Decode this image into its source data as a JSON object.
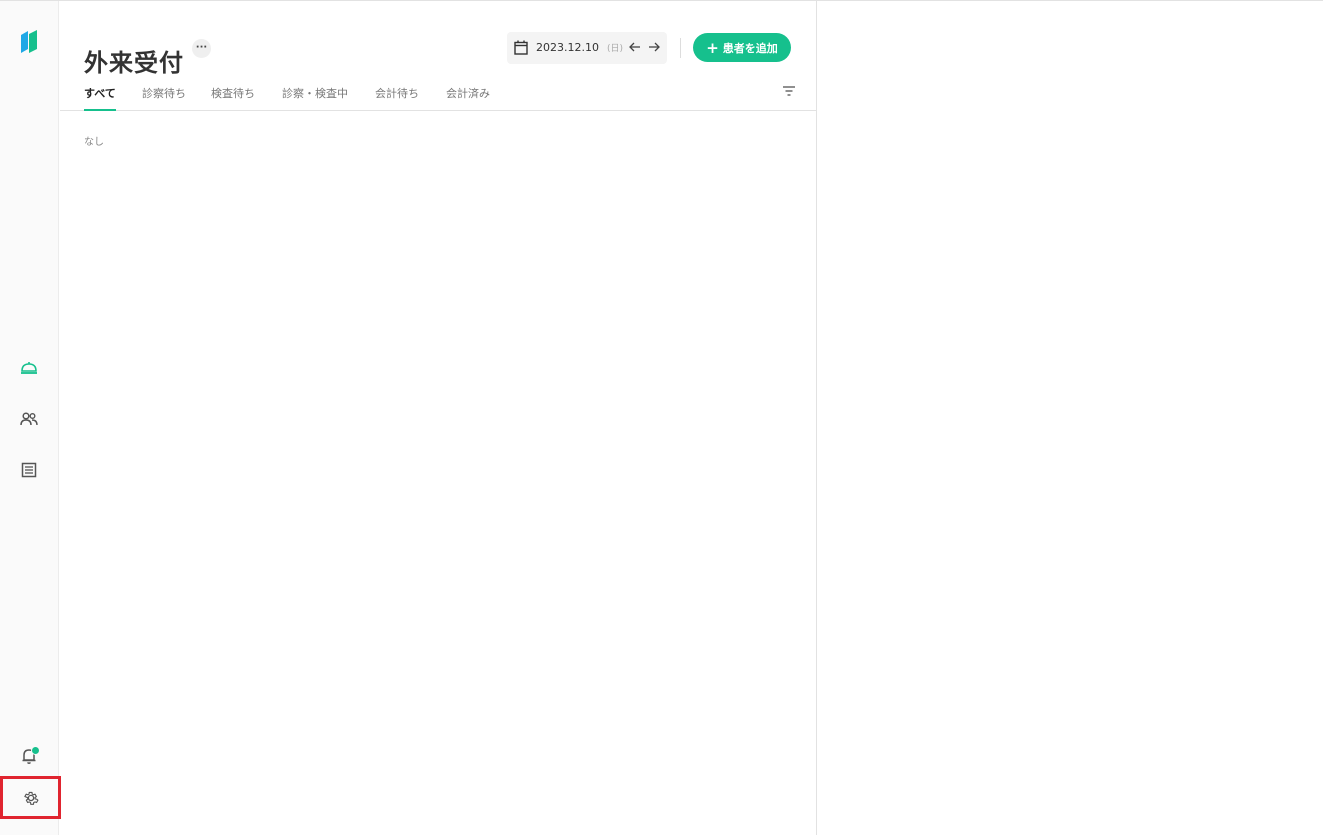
{
  "page": {
    "title": "外来受付",
    "more_label": "···",
    "empty_text": "なし"
  },
  "date": {
    "value": "2023.12.10",
    "weekday": "(日)"
  },
  "actions": {
    "add_patient": "患者を追加"
  },
  "tabs": [
    {
      "label": "すべて",
      "active": true
    },
    {
      "label": "診察待ち",
      "active": false
    },
    {
      "label": "検査待ち",
      "active": false
    },
    {
      "label": "診察・検査中",
      "active": false
    },
    {
      "label": "会計待ち",
      "active": false
    },
    {
      "label": "会計済み",
      "active": false
    }
  ],
  "rail": {
    "icons": [
      "logo-icon",
      "reception-bell-icon",
      "patients-icon",
      "records-icon",
      "notification-bell-icon",
      "gear-icon"
    ]
  },
  "colors": {
    "accent": "#16c08d",
    "highlight": "#e0242f"
  }
}
